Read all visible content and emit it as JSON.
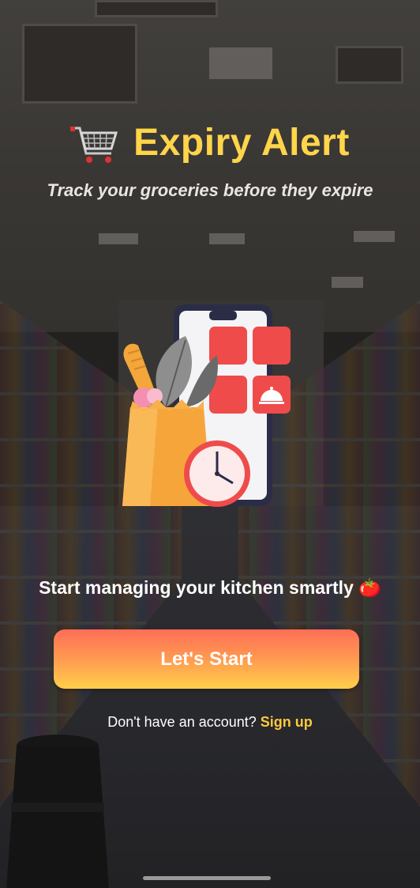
{
  "header": {
    "title": "Expiry Alert",
    "tagline": "Track your groceries before they expire"
  },
  "main": {
    "cta_text": "Start managing your kitchen smartly",
    "cta_emoji": "🍅",
    "start_button_label": "Let's Start"
  },
  "footer": {
    "signup_prompt": "Don't have an account?",
    "signup_link": "Sign up"
  },
  "colors": {
    "title": "#ffd54a",
    "signup_link": "#ffc93c",
    "button_gradient_top": "#ff6e57",
    "button_gradient_bottom": "#ffcf4a"
  },
  "icons": [
    "shopping-cart-icon",
    "grocery-phone-illustration",
    "clock-icon",
    "cloche-icon",
    "tomato-emoji"
  ]
}
